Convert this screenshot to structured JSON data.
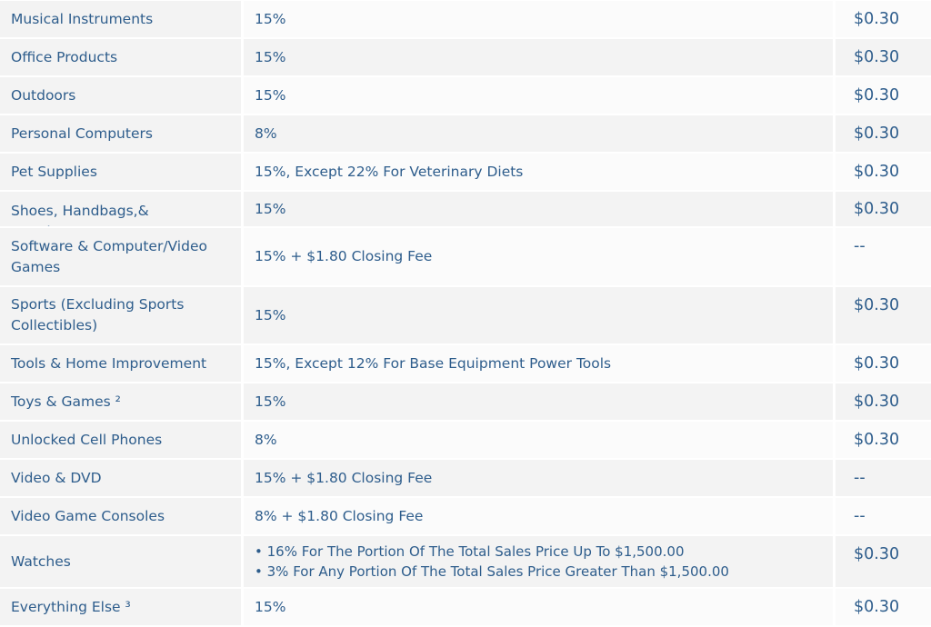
{
  "rows": [
    {
      "category": "Musical Instruments",
      "fee": "15%",
      "closing": "$0.30",
      "h": 40
    },
    {
      "category": "Office Products",
      "fee": "15%",
      "closing": "$0.30",
      "h": 40
    },
    {
      "category": "Outdoors",
      "fee": "15%",
      "closing": "$0.30",
      "h": 40
    },
    {
      "category": "Personal Computers",
      "fee": "8%",
      "closing": "$0.30",
      "h": 40
    },
    {
      "category": "Pet Supplies",
      "fee": "15%, Except 22% For Veterinary Diets",
      "closing": "$0.30",
      "h": 40
    },
    {
      "category": "Shoes, Handbags,& Sunglasses",
      "fee": "15%",
      "closing": "$0.30",
      "h": 38,
      "clip": true
    },
    {
      "category": "Software & Computer/Video Games",
      "fee": "15% + $1.80 Closing Fee",
      "closing": "--",
      "h": 63
    },
    {
      "category": "Sports (Excluding Sports Collectibles)",
      "fee": "15%",
      "closing": "$0.30",
      "h": 62
    },
    {
      "category": "Tools & Home Improvement",
      "fee": "15%, Except 12% For Base Equipment Power Tools",
      "closing": "$0.30",
      "h": 40
    },
    {
      "category": "Toys & Games ²",
      "fee": "15%",
      "closing": "$0.30",
      "h": 40
    },
    {
      "category": "Unlocked Cell Phones",
      "fee": "8%",
      "closing": "$0.30",
      "h": 40
    },
    {
      "category": "Video & DVD",
      "fee": "15% + $1.80 Closing Fee",
      "closing": "--",
      "h": 40
    },
    {
      "category": "Video Game Consoles",
      "fee": "8% + $1.80 Closing Fee",
      "closing": "--",
      "h": 40
    },
    {
      "category": "Watches",
      "fee_list": [
        "16% For The Portion Of The Total Sales Price Up To $1,500.00",
        "3% For Any Portion Of The Total Sales Price Greater Than $1,500.00"
      ],
      "closing": "$0.30",
      "h": 56
    },
    {
      "category": "Everything Else ³",
      "fee": "15%",
      "closing": "$0.30",
      "h": 40
    }
  ]
}
